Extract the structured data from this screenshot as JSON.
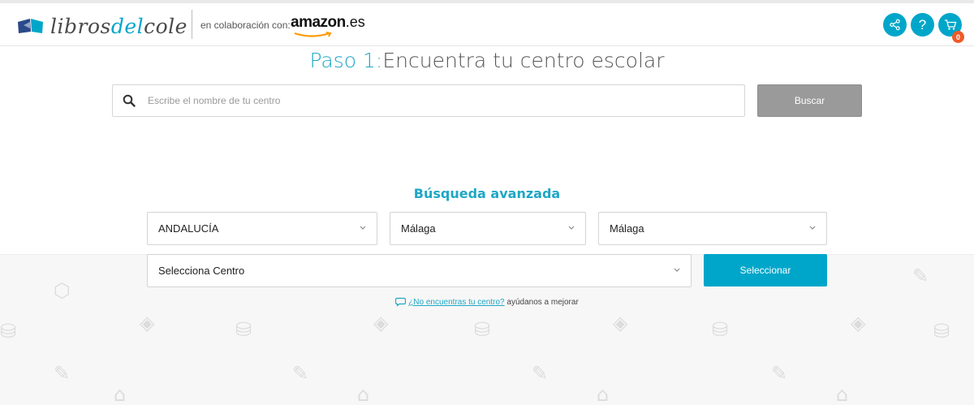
{
  "header": {
    "logo": {
      "part1": "libros",
      "part2": "del",
      "part3": "cole"
    },
    "collab_text": "en colaboración con:",
    "amazon": {
      "word": "amazon",
      "tld": ".es"
    },
    "help_glyph": "?",
    "cart_count": "0",
    "icons": [
      "share-icon",
      "help-icon",
      "cart-icon"
    ]
  },
  "step": {
    "prefix": "Paso 1:",
    "title": "Encuentra tu centro escolar"
  },
  "search": {
    "placeholder": "Escribe el nombre de tu centro",
    "button": "Buscar"
  },
  "advanced": {
    "title": "Búsqueda avanzada",
    "region": "ANDALUCÍA",
    "province": "Málaga",
    "city": "Málaga",
    "school": "Selecciona Centro",
    "select_button": "Seleccionar"
  },
  "help": {
    "link": "¿No encuentras tu centro?",
    "text": " ayúdanos a mejorar"
  },
  "colors": {
    "accent": "#00a6c9",
    "title_accent": "#1ea7c5",
    "badge": "#f05a28",
    "disabled_button": "#9a9a9a"
  }
}
